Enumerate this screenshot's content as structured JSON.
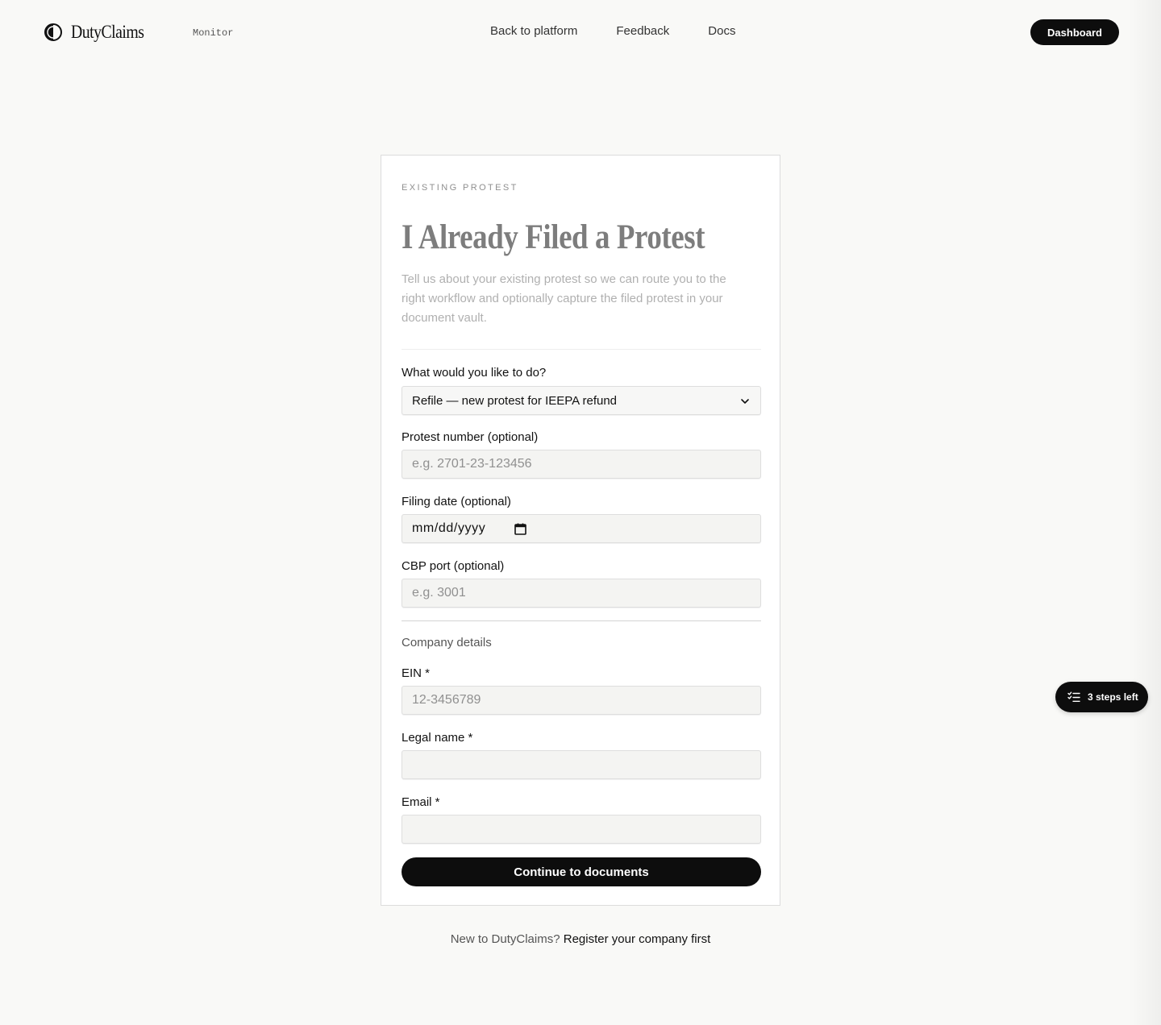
{
  "header": {
    "brand_name": "DutyClaims",
    "brand_sub": "Monitor",
    "nav": [
      "Back to platform",
      "Feedback",
      "Docs"
    ],
    "dashboard_label": "Dashboard"
  },
  "card": {
    "eyebrow": "EXISTING PROTEST",
    "title": "I Already Filed a Protest",
    "description": "Tell us about your existing protest so we can route you to the right workflow and optionally capture the filed protest in your document vault.",
    "action": {
      "label": "What would you like to do?",
      "selected": "Refile — new protest for IEEPA refund"
    },
    "protest_number": {
      "label": "Protest number (optional)",
      "placeholder": "e.g. 2701-23-123456"
    },
    "filing_date": {
      "label": "Filing date (optional)",
      "placeholder": "mm/dd/yyyy"
    },
    "cbp_port": {
      "label": "CBP port (optional)",
      "placeholder": "e.g. 3001"
    },
    "company_section": "Company details",
    "ein": {
      "label": "EIN *",
      "placeholder": "12-3456789"
    },
    "legal_name": {
      "label": "Legal name *",
      "placeholder": ""
    },
    "email": {
      "label": "Email *",
      "placeholder": ""
    },
    "submit_label": "Continue to documents"
  },
  "footer": {
    "prompt": "New to DutyClaims?",
    "link": "Register your company first"
  },
  "steps_pill": {
    "label": "3 steps left"
  },
  "colors": {
    "background": "#f9f9f7",
    "primary": "#0d0d0d",
    "card": "#ffffff",
    "field_bg": "#f4f4f2"
  },
  "icons": {
    "brand": "half-circle-logo-icon",
    "select": "chevron-down-icon",
    "date": "calendar-icon",
    "steps": "checklist-icon"
  }
}
